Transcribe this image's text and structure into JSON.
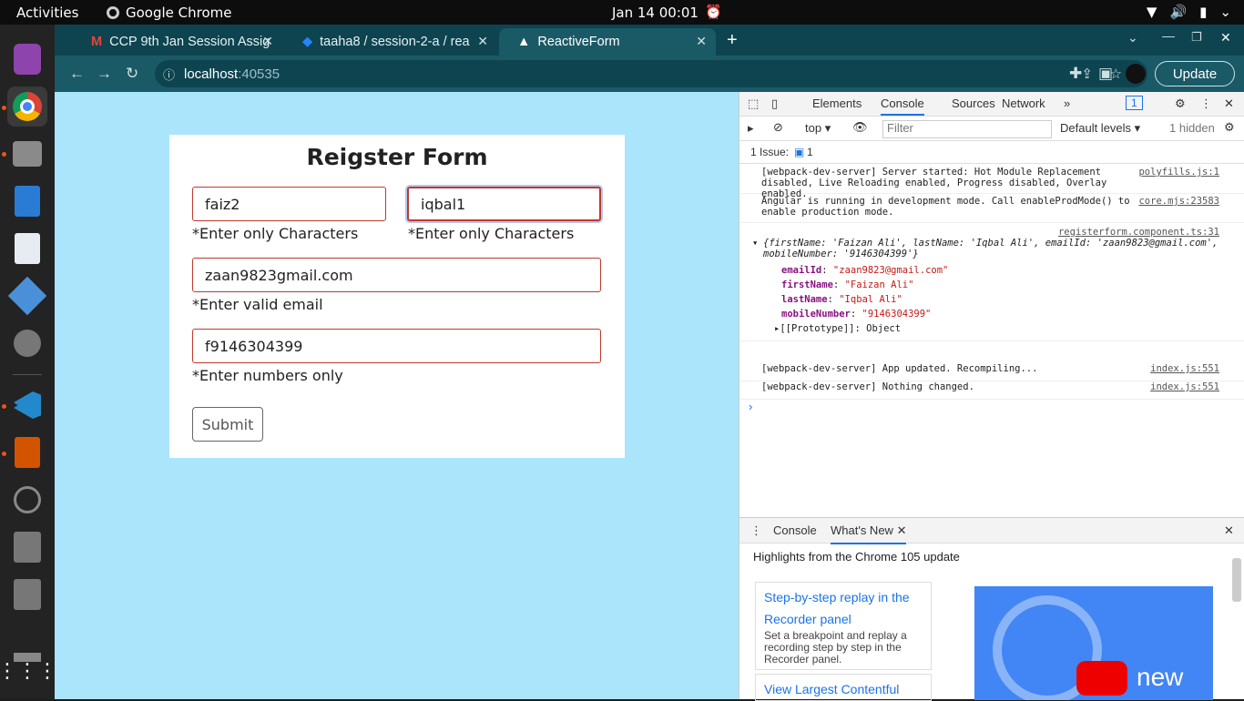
{
  "topbar": {
    "activities": "Activities",
    "app": "Google Chrome",
    "clock": "Jan 14  00:01"
  },
  "tabs": [
    {
      "label": "CCP 9th Jan Session Assig",
      "icon": "gmail-icon"
    },
    {
      "label": "taaha8 / session-2-a / rea",
      "icon": "bitbucket-icon"
    },
    {
      "label": "ReactiveForm",
      "icon": "angular-icon"
    }
  ],
  "address": {
    "host": "localhost",
    "port": ":40535"
  },
  "update_label": "Update",
  "form": {
    "title": "Reigster Form",
    "first_name": "faiz2",
    "first_hint": "*Enter only Characters",
    "last_name": "iqbal1",
    "last_hint": "*Enter only Characters",
    "email": "zaan9823gmail.com",
    "email_hint": "*Enter valid email",
    "mobile": "f9146304399",
    "mobile_hint": "*Enter numbers only",
    "submit": "Submit"
  },
  "devtools": {
    "tabs": [
      "Elements",
      "Console",
      "Sources",
      "Network"
    ],
    "badge": "1",
    "context": "top",
    "filter_placeholder": "Filter",
    "levels": "Default levels",
    "hidden": "1 hidden",
    "issues": "1 Issue:",
    "issues_count": "1",
    "logs": [
      {
        "text": "[webpack-dev-server] Server started: Hot Module Replacement disabled, Live Reloading enabled, Progress disabled, Overlay enabled.",
        "src": "polyfills.js:1"
      },
      {
        "text": "Angular is running in development mode. Call enableProdMode() to enable production mode.",
        "src": "core.mjs:23583"
      },
      {
        "text": "[webpack-dev-server] App updated. Recompiling...",
        "src": "index.js:551"
      },
      {
        "text": "[webpack-dev-server] Nothing changed.",
        "src": "index.js:551"
      }
    ],
    "object_src": "registerform.component.ts:31",
    "object_summary": "{firstName: 'Faizan Ali', lastName: 'Iqbal Ali', emailId: 'zaan9823@gmail.com', mobileNumber: '9146304399'}",
    "props": [
      {
        "k": "emailId",
        "v": "\"zaan9823@gmail.com\""
      },
      {
        "k": "firstName",
        "v": "\"Faizan Ali\""
      },
      {
        "k": "lastName",
        "v": "\"Iqbal Ali\""
      },
      {
        "k": "mobileNumber",
        "v": "\"9146304399\""
      }
    ],
    "prototype": "[[Prototype]]: Object",
    "drawer": {
      "tabs": [
        "Console",
        "What's New"
      ],
      "headline": "Highlights from the Chrome 105 update",
      "card1_title": "Step-by-step replay in the Recorder panel",
      "card1_desc": "Set a breakpoint and replay a recording step by step in the Recorder panel.",
      "card2_title": "View Largest Contentful",
      "thumb_text": "new"
    }
  }
}
